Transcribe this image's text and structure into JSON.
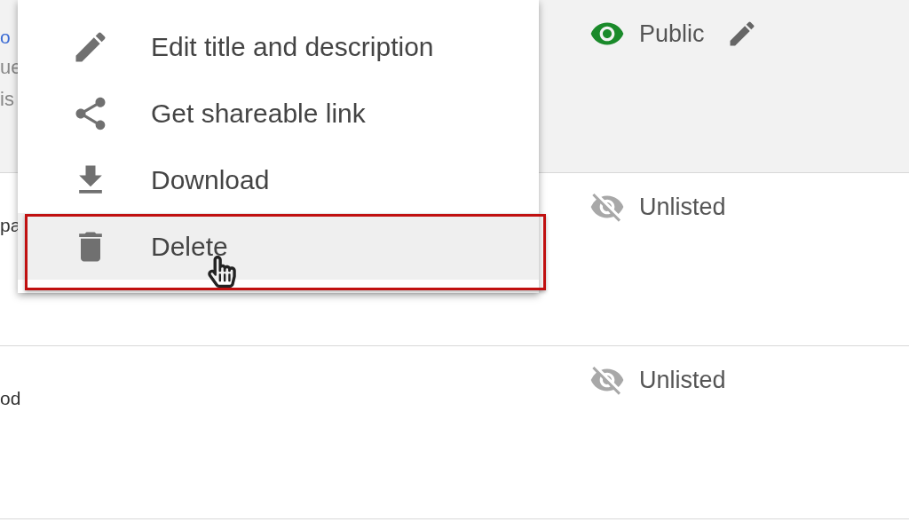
{
  "rows": [
    {
      "selected": true,
      "title_fragment": "o",
      "description_fragments": [
        "ue",
        "is"
      ],
      "visibility": {
        "kind": "public",
        "label": "Public"
      }
    },
    {
      "selected": false,
      "title_fragment": "pa",
      "description_fragments": [],
      "visibility": {
        "kind": "unlisted",
        "label": "Unlisted"
      }
    },
    {
      "selected": false,
      "title_fragment": "od",
      "description_fragments": [],
      "visibility": {
        "kind": "unlisted",
        "label": "Unlisted"
      }
    }
  ],
  "menu": {
    "items": [
      {
        "kind": "edit",
        "label": "Edit title and description",
        "selected": false,
        "highlighted": false
      },
      {
        "kind": "share",
        "label": "Get shareable link",
        "selected": false,
        "highlighted": false
      },
      {
        "kind": "download",
        "label": "Download",
        "selected": false,
        "highlighted": false
      },
      {
        "kind": "delete",
        "label": "Delete",
        "selected": true,
        "highlighted": true
      }
    ]
  }
}
